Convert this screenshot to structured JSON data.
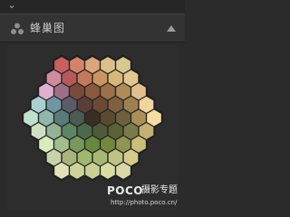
{
  "panel": {
    "title": "蜂巢图",
    "icon": "swatches-icon",
    "collapse_icon": "triangle-up-icon"
  },
  "honeycomb": {
    "rows": [
      [
        "#c9605e",
        "#d4836a",
        "#dba67b",
        "#dcc08a",
        "#d8c890"
      ],
      [
        "#cf8c9c",
        "#b6585a",
        "#c37a5a",
        "#c8945f",
        "#d6b879",
        "#e2c88f"
      ],
      [
        "#e0b0cf",
        "#9f6f88",
        "#7a4a3d",
        "#8b5a3d",
        "#9c7048",
        "#b08b5a",
        "#e2bf8c"
      ],
      [
        "#a9d0ce",
        "#6e97a2",
        "#5c5c68",
        "#5a3e37",
        "#6a4a34",
        "#80613f",
        "#9c8050",
        "#f0d49c"
      ],
      [
        "#bfe0cb",
        "#8fb7ad",
        "#5a7c78",
        "#4b5a52",
        "#3a2e22",
        "#5a4a2e",
        "#6e603b",
        "#aa9058",
        "#f4dca2"
      ],
      [
        "#cde0c3",
        "#93b394",
        "#5e8466",
        "#4c6a4a",
        "#4f5a3a",
        "#5a6235",
        "#7a7a48",
        "#c4b070"
      ],
      [
        "#d8ecc0",
        "#a2be8a",
        "#78985e",
        "#66883f",
        "#73873e",
        "#90964f",
        "#c8c07a"
      ],
      [
        "#c9d3a8",
        "#a7b47c",
        "#a0b86c",
        "#a8b872",
        "#bfc284",
        "#d4cc8c"
      ],
      [
        "#e2e0b8",
        "#cdd49a",
        "#cad095",
        "#dadca4",
        "#dad8a6"
      ]
    ]
  },
  "watermark": {
    "brand": "POCO",
    "chinese": "摄影专题",
    "url": "http://photo.poco.cn/"
  }
}
